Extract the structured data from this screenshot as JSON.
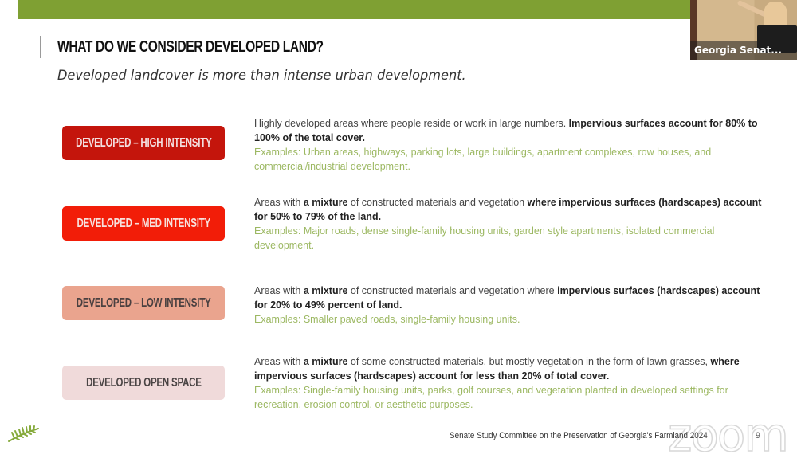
{
  "slide": {
    "title": "WHAT DO WE CONSIDER DEVELOPED LAND?",
    "subtitle": "Developed landcover is more than intense urban development.",
    "accent_color": "#7fa033",
    "categories": [
      {
        "label": "DEVELOPED – HIGH INTENSITY",
        "bg_color": "#c4150c",
        "text_color": "#f3dede",
        "desc_plain": "Highly developed areas where people reside or work in large numbers. ",
        "desc_bold": "Impervious surfaces account for 80% to 100% of the total cover.",
        "examples": "Examples: Urban areas, highways, parking lots, large buildings, apartment complexes, row houses, and commercial/industrial development."
      },
      {
        "label": "DEVELOPED – MED INTENSITY",
        "bg_color": "#f21d08",
        "text_color": "#f7e0dc",
        "desc_a": "Areas with ",
        "desc_b": "a mixture",
        "desc_c": " of constructed materials and vegetation ",
        "desc_d": "where impervious surfaces (hardscapes) account for 50% to 79% of the land.",
        "examples": "Examples: Major roads, dense single-family housing units, garden style apartments, isolated commercial development."
      },
      {
        "label": "DEVELOPED – LOW INTENSITY",
        "bg_color": "#eaa48e",
        "text_color": "#4a4040",
        "desc_a": "Areas with ",
        "desc_b": "a mixture",
        "desc_c": " of constructed materials and vegetation where ",
        "desc_d": "impervious surfaces (hardscapes) account for 20% to 49% percent of land.",
        "examples": "Examples: Smaller paved roads, single-family housing units."
      },
      {
        "label": "DEVELOPED  OPEN SPACE",
        "bg_color": "#f0dada",
        "text_color": "#4a4444",
        "desc_a": "Areas with ",
        "desc_b": "a mixture",
        "desc_c": " of some constructed materials, but mostly vegetation in the form of lawn grasses, ",
        "desc_d": "where impervious surfaces (hardscapes) account for less than 20% of total cover.",
        "examples": "Examples: Single-family housing units, parks, golf courses, and vegetation planted in developed settings for recreation, erosion control, or aesthetic purposes."
      }
    ],
    "footer": "Senate Study Committee on the Preservation of Georgia's Farmland 2024",
    "page_number": "| 9"
  },
  "video_tile": {
    "participant_name": "Georgia Senat..."
  },
  "watermark": "zoom"
}
